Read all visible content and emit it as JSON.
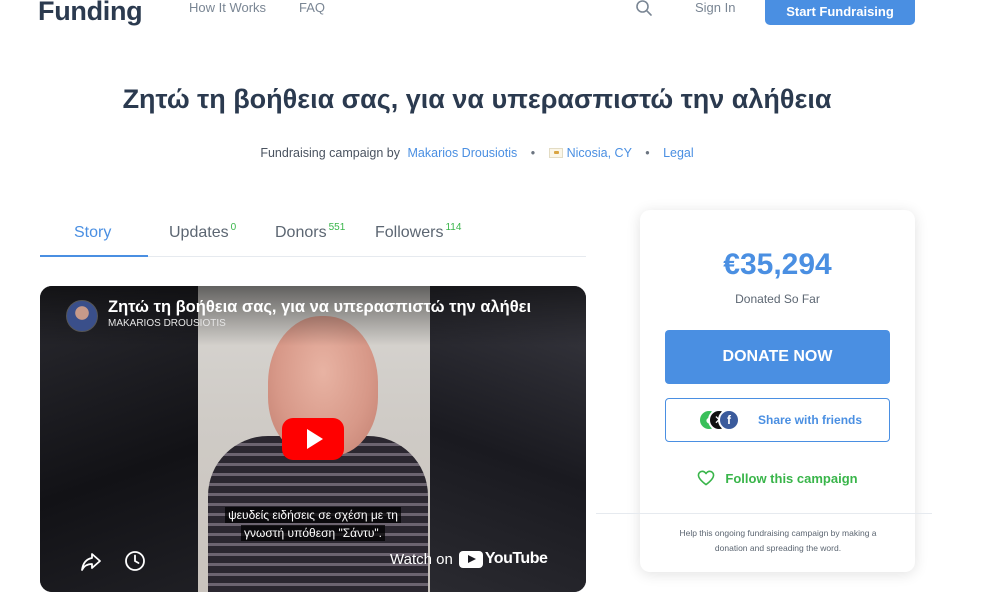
{
  "header": {
    "logo": "Funding",
    "nav": {
      "how_it_works": "How It Works",
      "faq": "FAQ"
    },
    "search_icon": "search-icon",
    "sign_in": "Sign In",
    "start_button": "Start Fundraising",
    "accent_color": "#4a8fe2"
  },
  "campaign": {
    "title": "Ζητώ τη βοήθεια σας, για να υπερασπιστώ την αλήθεια",
    "meta_prefix": "Fundraising campaign by",
    "organizer": "Makarios Drousiotis",
    "location": "Nicosia, CY",
    "legal": "Legal"
  },
  "tabs": {
    "story": "Story",
    "updates": {
      "label": "Updates",
      "count": "0"
    },
    "donors": {
      "label": "Donors",
      "count": "551"
    },
    "followers": {
      "label": "Followers",
      "count": "114"
    }
  },
  "video": {
    "title": "Ζητώ τη βοήθεια σας, για να υπερασπιστώ την αλήθει",
    "channel": "MAKARIOS DROUSIOTIS",
    "subtitle_line1": "ψευδείς ειδήσεις σε σχέση με τη",
    "subtitle_line2": "γνωστή υπόθεση \"Σάντυ\".",
    "watch_on": "Watch on",
    "youtube": "YouTube"
  },
  "donation": {
    "amount": "€35,294",
    "amount_label": "Donated So Far",
    "donate_button": "DONATE NOW",
    "share_label": "Share with friends",
    "follow_label": "Follow this campaign",
    "help_line1": "Help this ongoing fundraising campaign by making a",
    "help_line2": "donation and spreading the word.",
    "follow_color": "#39b54a"
  }
}
